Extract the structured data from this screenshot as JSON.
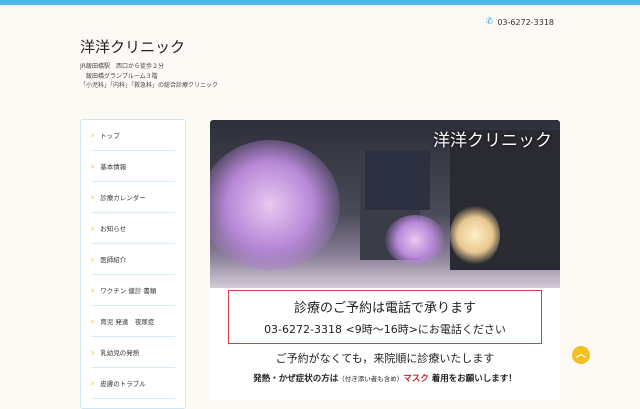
{
  "header": {
    "phone": "03-6272-3318",
    "title": "洋洋クリニック",
    "address": [
      "JR飯田橋駅　西口から徒歩２分",
      "　飯田橋グランブルーム３階",
      "「小児科」「内科」「救急科」の総合診療クリニック"
    ]
  },
  "nav": {
    "items": [
      {
        "label": "トップ"
      },
      {
        "label": "基本情報"
      },
      {
        "label": "診療カレンダー"
      },
      {
        "label": "お知らせ"
      },
      {
        "label": "医師紹介"
      },
      {
        "label": "ワクチン 健診 書類"
      },
      {
        "label": "育児 発達　夜尿症"
      },
      {
        "label": "乳幼児の発熱"
      },
      {
        "label": "皮膚のトラブル"
      }
    ]
  },
  "hero": {
    "title": "洋洋クリニック"
  },
  "notice": {
    "line1": "診療のご予約は電話で承ります",
    "line2": "03-6272-3318 <9時〜16時>にお電話ください",
    "line3": "ご予約がなくても，来院順に診療いたします",
    "line4a": "発熱・かぜ症状の方は",
    "line4b": "（付き添い者も含め）",
    "line4c": "マスク",
    "line4d": " 着用をお願いします！"
  },
  "colors": {
    "accent": "#4db8e8",
    "red": "#d02030",
    "yellow": "#f2c020"
  }
}
